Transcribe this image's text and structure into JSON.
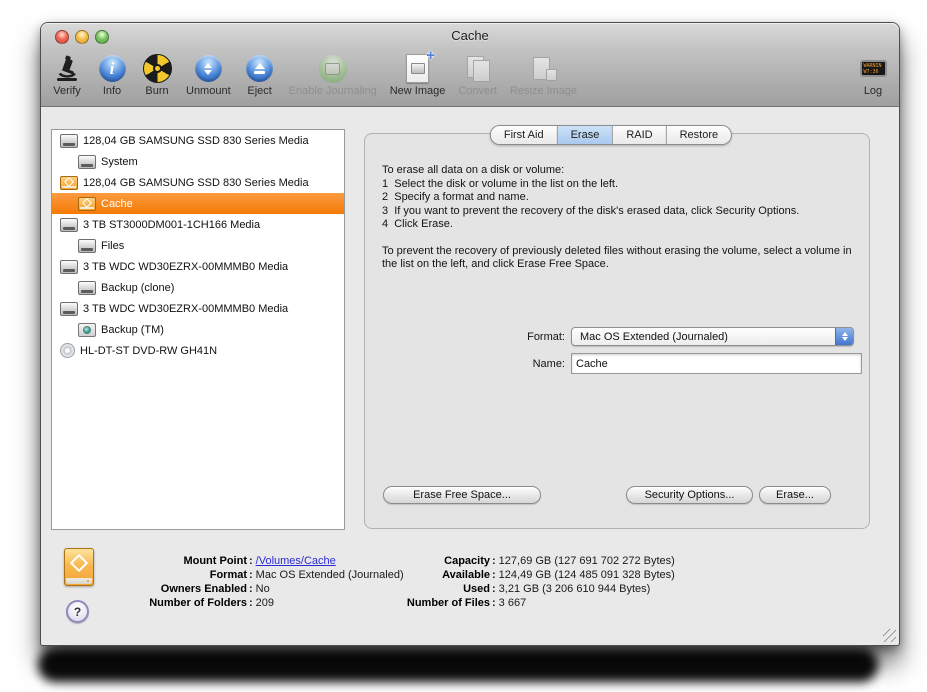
{
  "window": {
    "title": "Cache"
  },
  "colors": {
    "selection_orange": "#f57a05",
    "tab_selected_blue": "#a9c9ee",
    "link_blue": "#2b2bd4",
    "toolbar_blue_icon": "#4a86d8",
    "burn_yellow": "#f3c82b"
  },
  "toolbar": {
    "items": [
      {
        "label": "Verify",
        "enabled": true
      },
      {
        "label": "Info",
        "enabled": true
      },
      {
        "label": "Burn",
        "enabled": true
      },
      {
        "label": "Unmount",
        "enabled": true
      },
      {
        "label": "Eject",
        "enabled": true
      },
      {
        "label": "Enable Journaling",
        "enabled": false
      },
      {
        "label": "New Image",
        "enabled": true
      },
      {
        "label": "Convert",
        "enabled": false
      },
      {
        "label": "Resize Image",
        "enabled": false
      },
      {
        "label": "Log",
        "enabled": true
      }
    ],
    "log_lines": [
      "WARNIN",
      "W7:36"
    ]
  },
  "sidebar": {
    "items": [
      {
        "label": "128,04 GB SAMSUNG SSD 830 Series Media",
        "icon": "internal-disk",
        "level": 0,
        "selected": false
      },
      {
        "label": "System",
        "icon": "internal-disk",
        "level": 1,
        "selected": false
      },
      {
        "label": "128,04 GB SAMSUNG SSD 830 Series Media",
        "icon": "external-disk-orange",
        "level": 0,
        "selected": false
      },
      {
        "label": "Cache",
        "icon": "external-disk-orange",
        "level": 1,
        "selected": true
      },
      {
        "label": "3 TB ST3000DM001-1CH166 Media",
        "icon": "internal-disk",
        "level": 0,
        "selected": false
      },
      {
        "label": "Files",
        "icon": "internal-disk",
        "level": 1,
        "selected": false
      },
      {
        "label": "3 TB WDC WD30EZRX-00MMMB0 Media",
        "icon": "internal-disk",
        "level": 0,
        "selected": false
      },
      {
        "label": "Backup (clone)",
        "icon": "internal-disk",
        "level": 1,
        "selected": false
      },
      {
        "label": "3 TB WDC WD30EZRX-00MMMB0 Media",
        "icon": "internal-disk",
        "level": 0,
        "selected": false
      },
      {
        "label": "Backup (TM)",
        "icon": "timemachine-disk",
        "level": 1,
        "selected": false
      },
      {
        "label": "HL-DT-ST DVD-RW GH41N",
        "icon": "optical-disc",
        "level": 0,
        "selected": false
      }
    ]
  },
  "tabs": [
    {
      "label": "First Aid",
      "selected": false
    },
    {
      "label": "Erase",
      "selected": true
    },
    {
      "label": "RAID",
      "selected": false
    },
    {
      "label": "Restore",
      "selected": false
    }
  ],
  "erase_panel": {
    "intro": "To erase all data on a disk or volume:",
    "steps": [
      "1  Select the disk or volume in the list on the left.",
      "2  Specify a format and name.",
      "3  If you want to prevent the recovery of the disk's erased data, click Security Options.",
      "4  Click Erase."
    ],
    "note": "To prevent the recovery of previously deleted files without erasing the volume, select a volume in the list on the left, and click Erase Free Space.",
    "format_label": "Format:",
    "format_value": "Mac OS Extended (Journaled)",
    "name_label": "Name:",
    "name_value": "Cache",
    "buttons": {
      "erase_free_space": "Erase Free Space...",
      "security_options": "Security Options...",
      "erase": "Erase..."
    }
  },
  "footer": {
    "left": [
      {
        "label": "Mount Point",
        "value": "/Volumes/Cache"
      },
      {
        "label": "Format",
        "value": "Mac OS Extended (Journaled)"
      },
      {
        "label": "Owners Enabled",
        "value": "No"
      },
      {
        "label": "Number of Folders",
        "value": "209"
      }
    ],
    "right": [
      {
        "label": "Capacity",
        "value": "127,69 GB (127 691 702 272 Bytes)"
      },
      {
        "label": "Available",
        "value": "124,49 GB (124 485 091 328 Bytes)"
      },
      {
        "label": "Used",
        "value": "3,21 GB (3 206 610 944 Bytes)"
      },
      {
        "label": "Number of Files",
        "value": "3 667"
      }
    ]
  }
}
